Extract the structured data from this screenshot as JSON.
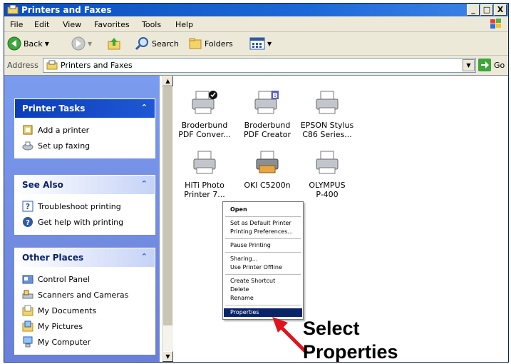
{
  "window": {
    "title": "Printers and Faxes",
    "buttons": [
      "_",
      "□",
      "X"
    ]
  },
  "menu": [
    "File",
    "Edit",
    "View",
    "Favorites",
    "Tools",
    "Help"
  ],
  "toolbar": {
    "back": "Back",
    "search": "Search",
    "folders": "Folders"
  },
  "address": {
    "label": "Address",
    "value": "Printers and Faxes",
    "go": "Go"
  },
  "panels": {
    "printer_tasks": {
      "title": "Printer Tasks",
      "items": [
        "Add a printer",
        "Set up faxing"
      ]
    },
    "see_also": {
      "title": "See Also",
      "items": [
        "Troubleshoot printing",
        "Get help with printing"
      ]
    },
    "other_places": {
      "title": "Other Places",
      "items": [
        "Control Panel",
        "Scanners and Cameras",
        "My Documents",
        "My Pictures",
        "My Computer"
      ]
    }
  },
  "printers": [
    {
      "line1": "Broderbund",
      "line2": "PDF Conver..."
    },
    {
      "line1": "Broderbund",
      "line2": "PDF Creator"
    },
    {
      "line1": "EPSON Stylus",
      "line2": "C86 Series..."
    },
    {
      "line1": "HiTi Photo",
      "line2": "Printer 7..."
    },
    {
      "line1": "OKI C5200n",
      "line2": ""
    },
    {
      "line1": "OLYMPUS",
      "line2": "P-400"
    }
  ],
  "context_menu": {
    "open": "Open",
    "set_default": "Set as Default Printer",
    "printing_prefs": "Printing Preferences...",
    "pause": "Pause Printing",
    "sharing": "Sharing...",
    "offline": "Use Printer Offline",
    "create_shortcut": "Create Shortcut",
    "delete": "Delete",
    "rename": "Rename",
    "properties": "Properties"
  },
  "annotation": {
    "line1": "Select",
    "line2": "Properties"
  },
  "colors": {
    "title_bar": "#0a4fbe",
    "panel_blue": "#0c3db7",
    "selected": "#0a246a",
    "arrow": "#e0141e"
  }
}
